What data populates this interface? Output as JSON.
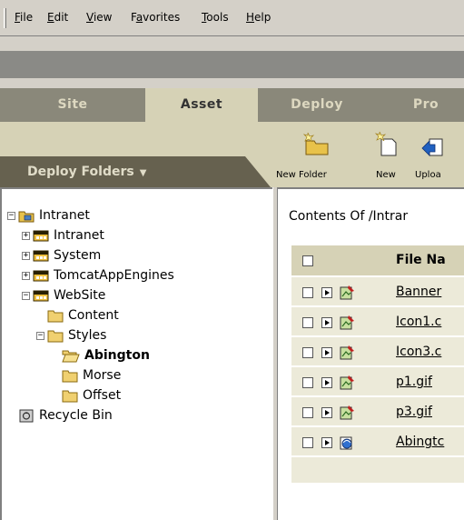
{
  "menu": {
    "items": [
      {
        "pre": "",
        "u": "F",
        "post": "ile"
      },
      {
        "pre": "",
        "u": "E",
        "post": "dit"
      },
      {
        "pre": "",
        "u": "V",
        "post": "iew"
      },
      {
        "pre": "F",
        "u": "a",
        "post": "vorites"
      },
      {
        "pre": "",
        "u": "T",
        "post": "ools"
      },
      {
        "pre": "",
        "u": "H",
        "post": "elp"
      }
    ]
  },
  "tabs": [
    {
      "label": "Site",
      "active": false
    },
    {
      "label": "Asset",
      "active": true
    },
    {
      "label": "Deploy",
      "active": false
    },
    {
      "label": "Pro",
      "active": false
    }
  ],
  "sidebar_header": {
    "label": "Deploy Folders",
    "arrow": "▼"
  },
  "toolbar": {
    "new_folder": "New Folder",
    "new": "New",
    "upload": "Uploa"
  },
  "tree": [
    {
      "label": "Intranet",
      "pm": "−",
      "icon": "site-icon",
      "bold": false
    },
    {
      "label": "Intranet",
      "pm": "+",
      "icon": "drive-icon",
      "bold": false
    },
    {
      "label": "System",
      "pm": "+",
      "icon": "drive-icon",
      "bold": false
    },
    {
      "label": "TomcatAppEngines",
      "pm": "+",
      "icon": "drive-icon",
      "bold": false
    },
    {
      "label": "WebSite",
      "pm": "−",
      "icon": "drive-icon",
      "bold": false
    },
    {
      "label": "Content",
      "pm": "",
      "icon": "folder-icon",
      "bold": false
    },
    {
      "label": "Styles",
      "pm": "−",
      "icon": "folder-icon",
      "bold": false
    },
    {
      "label": "Abington",
      "pm": "",
      "icon": "open-folder-icon",
      "bold": true
    },
    {
      "label": "Morse",
      "pm": "",
      "icon": "folder-icon",
      "bold": false
    },
    {
      "label": "Offset",
      "pm": "",
      "icon": "folder-icon",
      "bold": false
    },
    {
      "label": "Recycle Bin",
      "pm": "",
      "icon": "recycle-bin-icon",
      "bold": false
    }
  ],
  "contents_label": "Contents Of /Intrar",
  "table": {
    "header": "File Na",
    "rows": [
      {
        "name": "Banner",
        "icon": "image-file-icon"
      },
      {
        "name": "Icon1.c",
        "icon": "image-file-icon"
      },
      {
        "name": "Icon3.c",
        "icon": "image-file-icon"
      },
      {
        "name": "p1.gif",
        "icon": "image-file-icon"
      },
      {
        "name": "p3.gif",
        "icon": "image-file-icon"
      },
      {
        "name": "Abingtc",
        "icon": "web-file-icon"
      }
    ]
  },
  "colors": {
    "tab_bar": "#8a887a",
    "tab_active": "#d6d2b6",
    "sidebar_header": "#66614f",
    "row_bg": "#ecead9"
  }
}
